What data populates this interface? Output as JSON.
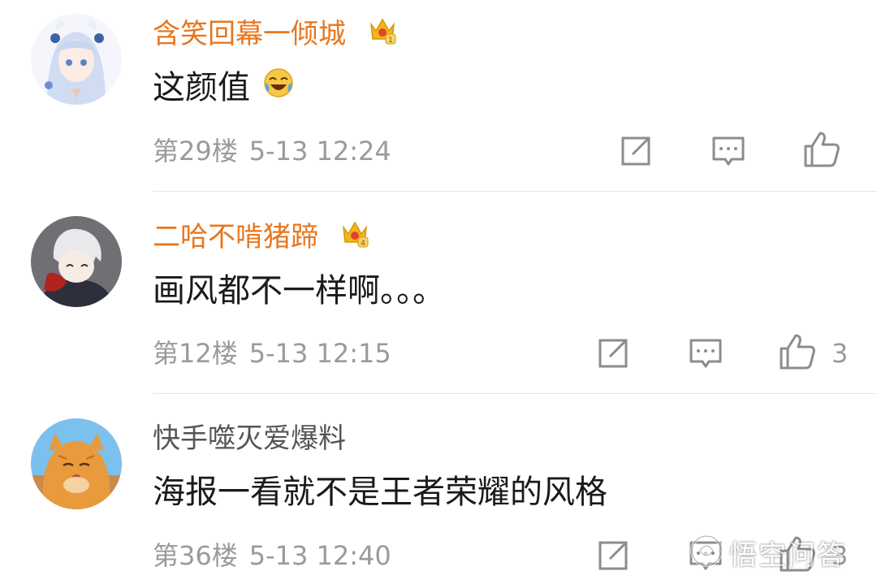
{
  "comments": [
    {
      "username": "含笑回幕一倾城",
      "vip_level": "1",
      "text": "这颜值",
      "floor": "第29楼",
      "time": "5-13 12:24",
      "likes": ""
    },
    {
      "username": "二哈不啃猪蹄",
      "vip_level": "4",
      "text": "画风都不一样啊。。。",
      "floor": "第12楼",
      "time": "5-13 12:15",
      "likes": "3"
    },
    {
      "username": "快手噬灭爱爆料",
      "vip_level": "",
      "text": "海报一看就不是王者荣耀的风格",
      "floor": "第36楼",
      "time": "5-13 12:40",
      "likes": "3"
    }
  ],
  "icons": {
    "repost": "repost-icon",
    "comment": "comment-icon",
    "like": "thumbs-up-icon",
    "crown": "vip-crown-icon",
    "emoji": "laugh-cry-emoji"
  },
  "colors": {
    "vip_name": "#e8761f",
    "normal_name": "#555555",
    "meta": "#9a9a9a",
    "text": "#1a1a1a",
    "divider": "#e6e6e6",
    "crown": "#f2b51a"
  },
  "watermark": {
    "text": "悟空问答"
  }
}
